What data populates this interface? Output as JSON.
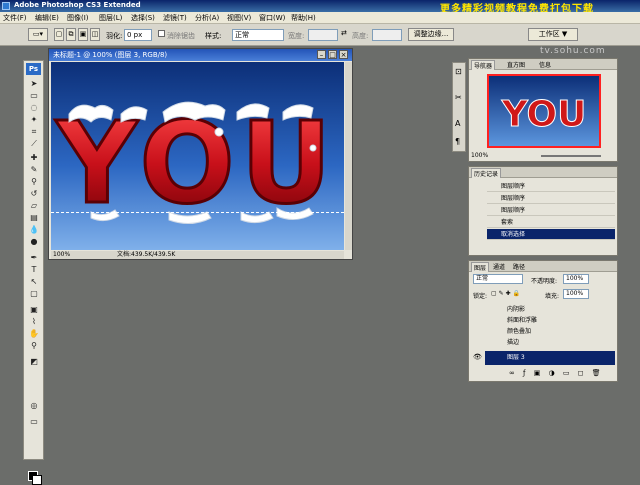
{
  "app": {
    "title": "Adobe Photoshop CS3 Extended",
    "promo_banner": "更多精彩视频教程免费打包下载",
    "watermark": "tv.sohu.com"
  },
  "menu": [
    "文件(F)",
    "编辑(E)",
    "图像(I)",
    "图层(L)",
    "选择(S)",
    "滤镜(T)",
    "分析(A)",
    "视图(V)",
    "窗口(W)",
    "帮助(H)"
  ],
  "options_bar": {
    "feather_label": "羽化:",
    "feather_value": "0 px",
    "antialias_label": "消除锯齿",
    "style_label": "样式:",
    "style_value": "正常",
    "width_label": "宽度:",
    "height_label": "高度:",
    "refine_edge_button": "调整边缘...",
    "workspace_button": "工作区 ▼"
  },
  "document": {
    "title": "未标题-1 @ 100% (图层 3, RGB/8)",
    "canvas_text": "YOU",
    "zoom": "100%",
    "doc_info": "文档:439.5K/439.5K"
  },
  "navigator": {
    "tabs": [
      "导航器",
      "直方图",
      "信息"
    ],
    "zoom": "100%"
  },
  "history": {
    "tab": "历史记录",
    "items": [
      "图层顺序",
      "图层顺序",
      "图层顺序",
      "套索",
      "取消选择"
    ],
    "selected_index": 4
  },
  "layers": {
    "tabs": [
      "图层",
      "通道",
      "路径"
    ],
    "blend_mode": "正常",
    "opacity_label": "不透明度:",
    "opacity_value": "100%",
    "lock_label": "锁定:",
    "fill_label": "填充:",
    "fill_value": "100%",
    "effects": [
      "内阴影",
      "斜面和浮雕",
      "颜色叠加",
      "描边"
    ],
    "selected_layer": "图层 3"
  },
  "colors": {
    "title_bar": "#0a246a",
    "promo": "#ffe600",
    "text_red": "#c8101a",
    "canvas_top": "#0c2f78",
    "canvas_bottom": "#7fb0ea"
  }
}
